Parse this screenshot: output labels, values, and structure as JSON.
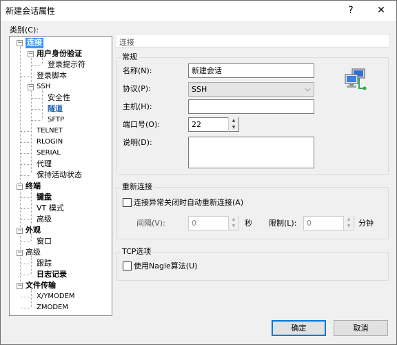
{
  "title": "新建会话属性",
  "titlebar": {
    "help": "?",
    "close": "✕"
  },
  "category_label": "类别(C):",
  "tree": [
    {
      "label": "连接",
      "level": 0,
      "expanded": true,
      "selected": true,
      "bold": true
    },
    {
      "label": "用户身份验证",
      "level": 1,
      "expanded": true,
      "bold": true
    },
    {
      "label": "登录提示符",
      "level": 2
    },
    {
      "label": "登录脚本",
      "level": 1
    },
    {
      "label": "SSH",
      "level": 1,
      "expanded": true,
      "small": true
    },
    {
      "label": "安全性",
      "level": 2
    },
    {
      "label": "隧道",
      "level": 2,
      "bold": true,
      "highlight": true
    },
    {
      "label": "SFTP",
      "level": 2,
      "small": true
    },
    {
      "label": "TELNET",
      "level": 1,
      "small": true
    },
    {
      "label": "RLOGIN",
      "level": 1,
      "small": true
    },
    {
      "label": "SERIAL",
      "level": 1,
      "small": true
    },
    {
      "label": "代理",
      "level": 1
    },
    {
      "label": "保持活动状态",
      "level": 1
    },
    {
      "label": "终端",
      "level": 0,
      "expanded": true,
      "bold": true
    },
    {
      "label": "键盘",
      "level": 1,
      "bold": true
    },
    {
      "label": "VT 模式",
      "level": 1
    },
    {
      "label": "高级",
      "level": 1
    },
    {
      "label": "外观",
      "level": 0,
      "expanded": true,
      "bold": true
    },
    {
      "label": "窗口",
      "level": 1
    },
    {
      "label": "高级",
      "level": 0,
      "expanded": true
    },
    {
      "label": "跟踪",
      "level": 1
    },
    {
      "label": "日志记录",
      "level": 1,
      "bold": true
    },
    {
      "label": "文件传输",
      "level": 0,
      "expanded": true,
      "bold": true
    },
    {
      "label": "X/YMODEM",
      "level": 1,
      "small": true
    },
    {
      "label": "ZMODEM",
      "level": 1,
      "small": true
    }
  ],
  "panel_header": "连接",
  "general": {
    "title": "常规",
    "name_label": "名称(N):",
    "name_value": "新建会话",
    "protocol_label": "协议(P):",
    "protocol_value": "SSH",
    "host_label": "主机(H):",
    "host_value": "",
    "port_label": "端口号(O):",
    "port_value": "22",
    "desc_label": "说明(D):",
    "desc_value": ""
  },
  "reconnect": {
    "title": "重新连接",
    "checkbox_label": "连接异常关闭时自动重新连接(A)",
    "interval_label": "间隔(V):",
    "interval_value": "0",
    "seconds_unit": "秒",
    "limit_label": "限制(L):",
    "limit_value": "0",
    "minutes_unit": "分钟"
  },
  "tcp": {
    "title": "TCP选项",
    "nagle_label": "使用Nagle算法(U)"
  },
  "buttons": {
    "ok": "确定",
    "cancel": "取消"
  },
  "colors": {
    "selection": "#3399ff",
    "tunnel": "#1a5fb4",
    "default_border": "#0078d7"
  }
}
